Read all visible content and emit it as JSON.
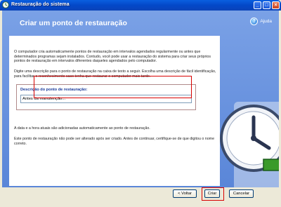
{
  "window": {
    "title": "Restauração do sistema"
  },
  "header": {
    "page_title": "Criar um ponto de restauração",
    "help_label": "Ajuda"
  },
  "body": {
    "paragraph_1": "O computador cria automaticamente pontos de restauração em intervalos agendados regularmente ou antes que determinados programas sejam instalados. Contudo, você pode usar a restauração do sistema para criar seus próprios pontos de restauração em intervalos diferentes daqueles agendados pelo computador.",
    "paragraph_2": "Digite uma descrição para o ponto de restauração na caixa de texto a seguir. Escolha uma descrição de fácil identificação, para facilitar o reconhecimento caso tenha que restaurar o computador mais tarde.",
    "description_label": "Descrição do ponto de restauração:",
    "description_value": "Antes da manutenção...",
    "paragraph_3": "A data e a hora atuais são adicionadas automaticamente ao ponto de restauração.",
    "paragraph_4": "Este ponto de restauração não pode ser alterado após ser criado. Antes de continuar, certifique-se de que digitou o nome correto."
  },
  "buttons": {
    "back": "< Voltar",
    "create": "Criar",
    "cancel": "Cancelar"
  },
  "colors": {
    "accent_blue": "#5a86d8",
    "highlight_red": "#d80000",
    "title_bar": "#0348c8"
  }
}
